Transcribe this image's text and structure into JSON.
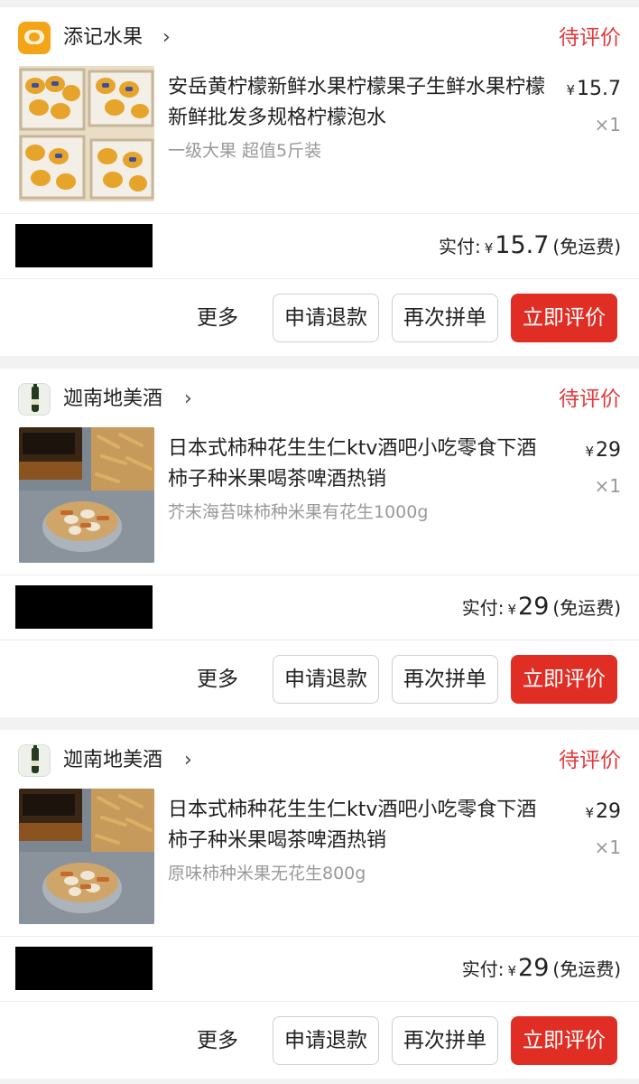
{
  "orders": [
    {
      "shop_name": "添记水果",
      "shop_icon": "fruit-shop-logo-icon",
      "status": "待评价",
      "product_title": "安岳黄柠檬新鲜水果柠檬果子生鲜水果柠檬新鲜批发多规格柠檬泡水",
      "product_spec": "一级大果 超值5斤装",
      "price_currency": "¥",
      "price": "15.7",
      "quantity": "×1",
      "paid_label": "实付:",
      "paid_currency": "¥",
      "paid_amount": "15.7",
      "shipping_note": "(免运费)",
      "actions": {
        "more": "更多",
        "refund": "申请退款",
        "rebuy": "再次拼单",
        "review": "立即评价"
      }
    },
    {
      "shop_name": "迦南地美酒",
      "shop_icon": "wine-shop-logo-icon",
      "status": "待评价",
      "product_title": "日本式柿种花生生仁ktv酒吧小吃零食下酒柿子种米果喝茶啤酒热销",
      "product_spec": "芥末海苔味柿种米果有花生1000g",
      "price_currency": "¥",
      "price": "29",
      "quantity": "×1",
      "paid_label": "实付:",
      "paid_currency": "¥",
      "paid_amount": "29",
      "shipping_note": "(免运费)",
      "actions": {
        "more": "更多",
        "refund": "申请退款",
        "rebuy": "再次拼单",
        "review": "立即评价"
      }
    },
    {
      "shop_name": "迦南地美酒",
      "shop_icon": "wine-shop-logo-icon",
      "status": "待评价",
      "product_title": "日本式柿种花生生仁ktv酒吧小吃零食下酒柿子种米果喝茶啤酒热销",
      "product_spec": "原味柿种米果无花生800g",
      "price_currency": "¥",
      "price": "29",
      "quantity": "×1",
      "paid_label": "实付:",
      "paid_currency": "¥",
      "paid_amount": "29",
      "shipping_note": "(免运费)",
      "actions": {
        "more": "更多",
        "refund": "申请退款",
        "rebuy": "再次拼单",
        "review": "立即评价"
      }
    }
  ],
  "colors": {
    "status_red": "#e4393c",
    "primary_button": "#e02e24",
    "secondary_text": "#999999",
    "page_background": "#f2f2f2"
  }
}
